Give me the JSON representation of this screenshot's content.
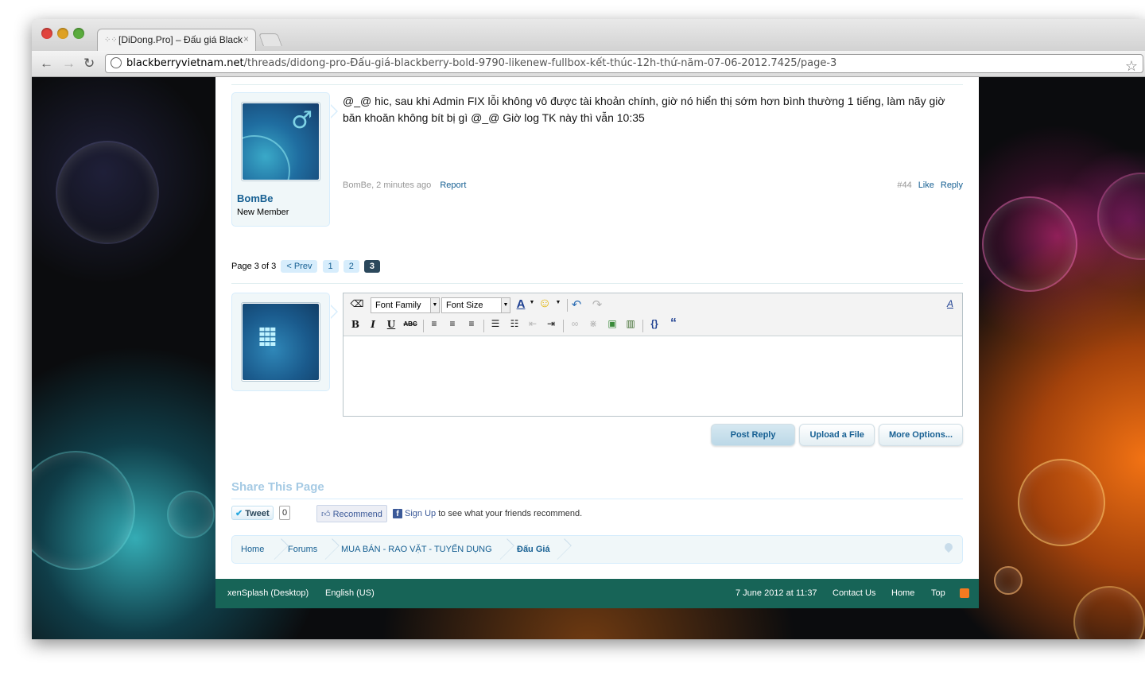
{
  "browser": {
    "tab_title": "[DiDong.Pro] – Đấu giá Black",
    "tab_close": "×",
    "url_host": "blackberryvietnam.net",
    "url_path": "/threads/didong-pro-Đấu-giá-blackberry-bold-9790-likenew-fullbox-kết-thúc-12h-thứ-năm-07-06-2012.7425/page-3"
  },
  "post": {
    "username": "BomBe",
    "user_title": "New Member",
    "message": "@_@ hic, sau khi Admin FIX lỗi không vô được tài khoản chính, giờ nó hiển thị sớm hơn bình thường 1 tiếng, làm nãy giờ băn khoăn không bít bị gì @_@ Giờ log TK này thì vẫn 10:35",
    "meta_author_time": "BomBe, 2 minutes ago",
    "report_label": "Report",
    "post_number": "#44",
    "like_label": "Like",
    "reply_label": "Reply"
  },
  "pagination": {
    "label": "Page 3 of 3",
    "prev_label": "< Prev",
    "pages": [
      "1",
      "2",
      "3"
    ],
    "current_page": "3"
  },
  "editor": {
    "font_family": "Font Family",
    "font_size": "Font Size",
    "bold": "B",
    "italic": "I",
    "underline": "U",
    "strike": "ABC",
    "quote": "“",
    "code": "{}",
    "toggle": "A",
    "content": ""
  },
  "actions": {
    "post_reply": "Post Reply",
    "upload_file": "Upload a File",
    "more_options": "More Options..."
  },
  "share": {
    "title": "Share This Page",
    "tweet_label": "Tweet",
    "tweet_count": "0",
    "recommend_label": "Recommend",
    "signup_link": "Sign Up",
    "signup_text": " to see what your friends recommend."
  },
  "breadcrumb": [
    "Home",
    "Forums",
    "MUA BÁN - RAO VẶT - TUYỂN DỤNG",
    "Đấu Giá"
  ],
  "footer": {
    "style_chooser": "xenSplash (Desktop)",
    "language": "English (US)",
    "datetime": "7 June 2012 at 11:37",
    "contact": "Contact Us",
    "home": "Home",
    "top": "Top"
  },
  "colors": {
    "link": "#176093",
    "footer_bg": "#176457",
    "current_page_bg": "#2b485c",
    "share_title": "#a5cae4"
  },
  "icons": [
    "back-icon",
    "forward-icon",
    "reload-icon",
    "globe-icon",
    "bookmark-star-icon",
    "male-icon",
    "blackberry-logo-icon",
    "rss-icon",
    "pin-icon"
  ]
}
